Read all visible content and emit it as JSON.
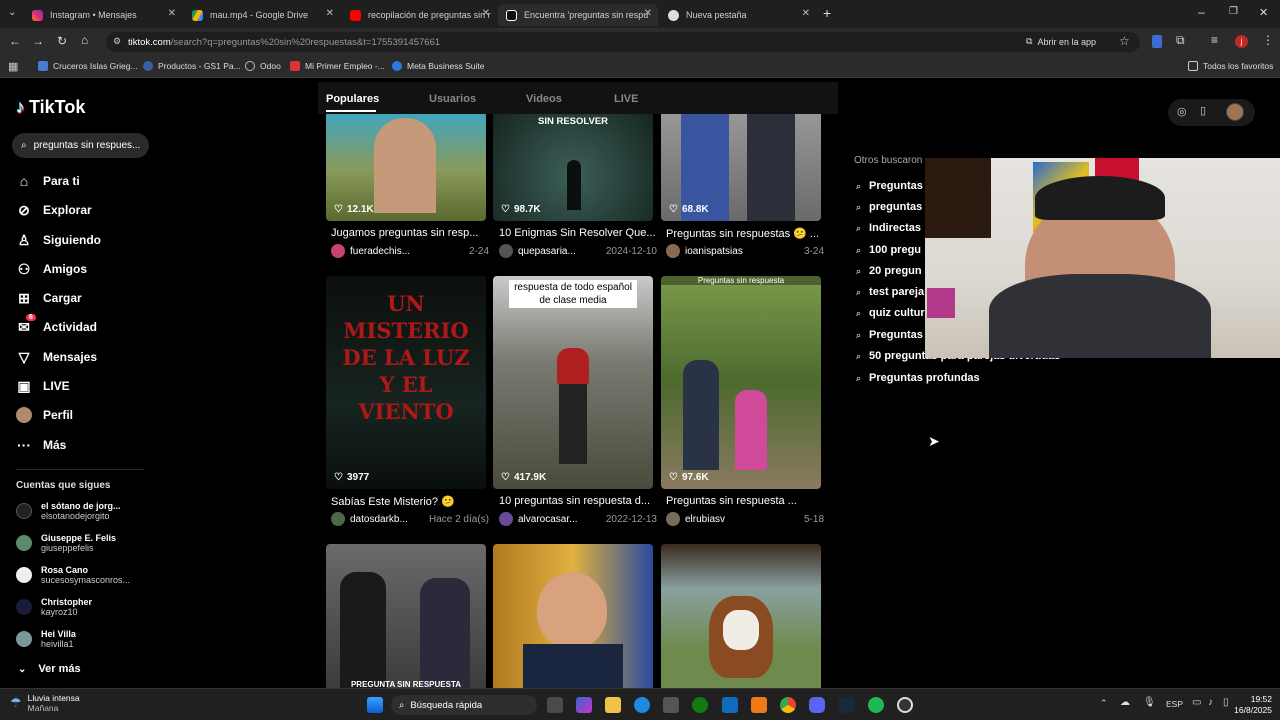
{
  "browser": {
    "tabs": [
      {
        "title": "Instagram • Mensajes",
        "color": "#e1306c"
      },
      {
        "title": "mau.mp4 - Google Drive",
        "color": "#f4b400"
      },
      {
        "title": "recopilación de preguntas sin r",
        "color": "#ff0000"
      },
      {
        "title": "Encuentra 'preguntas sin respu",
        "color": "#ffffff"
      },
      {
        "title": "Nueva pestaña",
        "color": "#dddddd"
      }
    ],
    "url_domain": "tiktok.com",
    "url_path": "/search?q=preguntas%20sin%20respuestas&t=1755391457661",
    "open_in_app": "Abrir en la app",
    "bookmarks": [
      "Cruceros Islas Grieg...",
      "Productos - GS1 Pa...",
      "Odoo",
      "Mi Primer Empleo -...",
      "Meta Business Suite"
    ],
    "all_favorites": "Todos los favoritos"
  },
  "tiktok": {
    "logo": "TikTok",
    "search_value": "preguntas sin respues...",
    "nav": [
      {
        "label": "Para ti",
        "icon": "home-icon"
      },
      {
        "label": "Explorar",
        "icon": "compass-icon"
      },
      {
        "label": "Siguiendo",
        "icon": "following-icon"
      },
      {
        "label": "Amigos",
        "icon": "friends-icon"
      },
      {
        "label": "Cargar",
        "icon": "upload-icon"
      },
      {
        "label": "Actividad",
        "icon": "activity-icon",
        "badge": "6"
      },
      {
        "label": "Mensajes",
        "icon": "messages-icon"
      },
      {
        "label": "LIVE",
        "icon": "live-icon"
      },
      {
        "label": "Perfil",
        "icon": "avatar"
      },
      {
        "label": "Más",
        "icon": "more-icon"
      }
    ],
    "following_title": "Cuentas que sigues",
    "following": [
      {
        "name": "el sótano de jorg...",
        "handle": "elsotanodejorgito"
      },
      {
        "name": "Giuseppe E. Felis",
        "handle": "giuseppefelis"
      },
      {
        "name": "Rosa Cano",
        "handle": "sucesosymasconros..."
      },
      {
        "name": "Christopher",
        "handle": "kayroz10"
      },
      {
        "name": "Hei Villa",
        "handle": "heivilla1"
      }
    ],
    "see_more": "Ver más",
    "tabs": [
      "Populares",
      "Usuarios",
      "Videos",
      "LIVE"
    ],
    "videos": [
      {
        "likes": "12.1K",
        "title": "Jugamos preguntas sin resp...",
        "author": "fueradechis...",
        "date": "2-24",
        "overlay": "",
        "bg": "#6b7a4a"
      },
      {
        "likes": "98.7K",
        "title": "10 Enigmas Sin Resolver Que...",
        "author": "quepasaria...",
        "date": "2024-12-10",
        "overlay": "SIN RESOLVER",
        "bg": "#2f4a46"
      },
      {
        "likes": "68.8K",
        "title": "Preguntas sin respuestas 😕 ...",
        "author": "ioanispatsias",
        "date": "3-24",
        "overlay": "",
        "bg": "#8a8a8a"
      },
      {
        "likes": "3977",
        "title": "Sabías Este Misterio? 😕",
        "author": "datosdarkb...",
        "date": "Hace 2 día(s)",
        "overlay": "UN MISTERIO DE LA LUZ Y EL VIENTO",
        "bg": "#0e1613"
      },
      {
        "likes": "417.9K",
        "title": "10 preguntas sin respuesta d...",
        "author": "alvarocasar...",
        "date": "2022-12-13",
        "overlay": "respuesta de todo español de clase media",
        "bg": "#5e5a52"
      },
      {
        "likes": "97.6K",
        "title": "Preguntas sin respuesta ...",
        "author": "elrubiasv",
        "date": "5-18",
        "overlay": "Preguntas sin respuesta",
        "bg": "#55673d"
      },
      {
        "likes": "",
        "title": "",
        "author": "",
        "date": "",
        "overlay": "PREGUNTA SIN RESPUESTA",
        "bg": "#4a4a4a"
      },
      {
        "likes": "",
        "title": "",
        "author": "",
        "date": "",
        "overlay": "",
        "bg": "#b8862c"
      },
      {
        "likes": "",
        "title": "",
        "author": "",
        "date": "",
        "overlay": "",
        "bg": "#6b7d4f"
      }
    ],
    "related_title": "Otros buscaron",
    "related": [
      "Preguntas",
      "preguntas",
      "Indirectas",
      "100 pregu",
      "20 pregun",
      "test pareja",
      "quiz cultur",
      "Preguntas",
      "50 preguntas para parejas divertidas",
      "Preguntas profundas"
    ]
  },
  "taskbar": {
    "weather_title": "Lluvia intensa",
    "weather_sub": "Mañana",
    "search": "Búsqueda rápida",
    "lang": "ESP",
    "time": "19:52",
    "date": "16/8/2025"
  }
}
